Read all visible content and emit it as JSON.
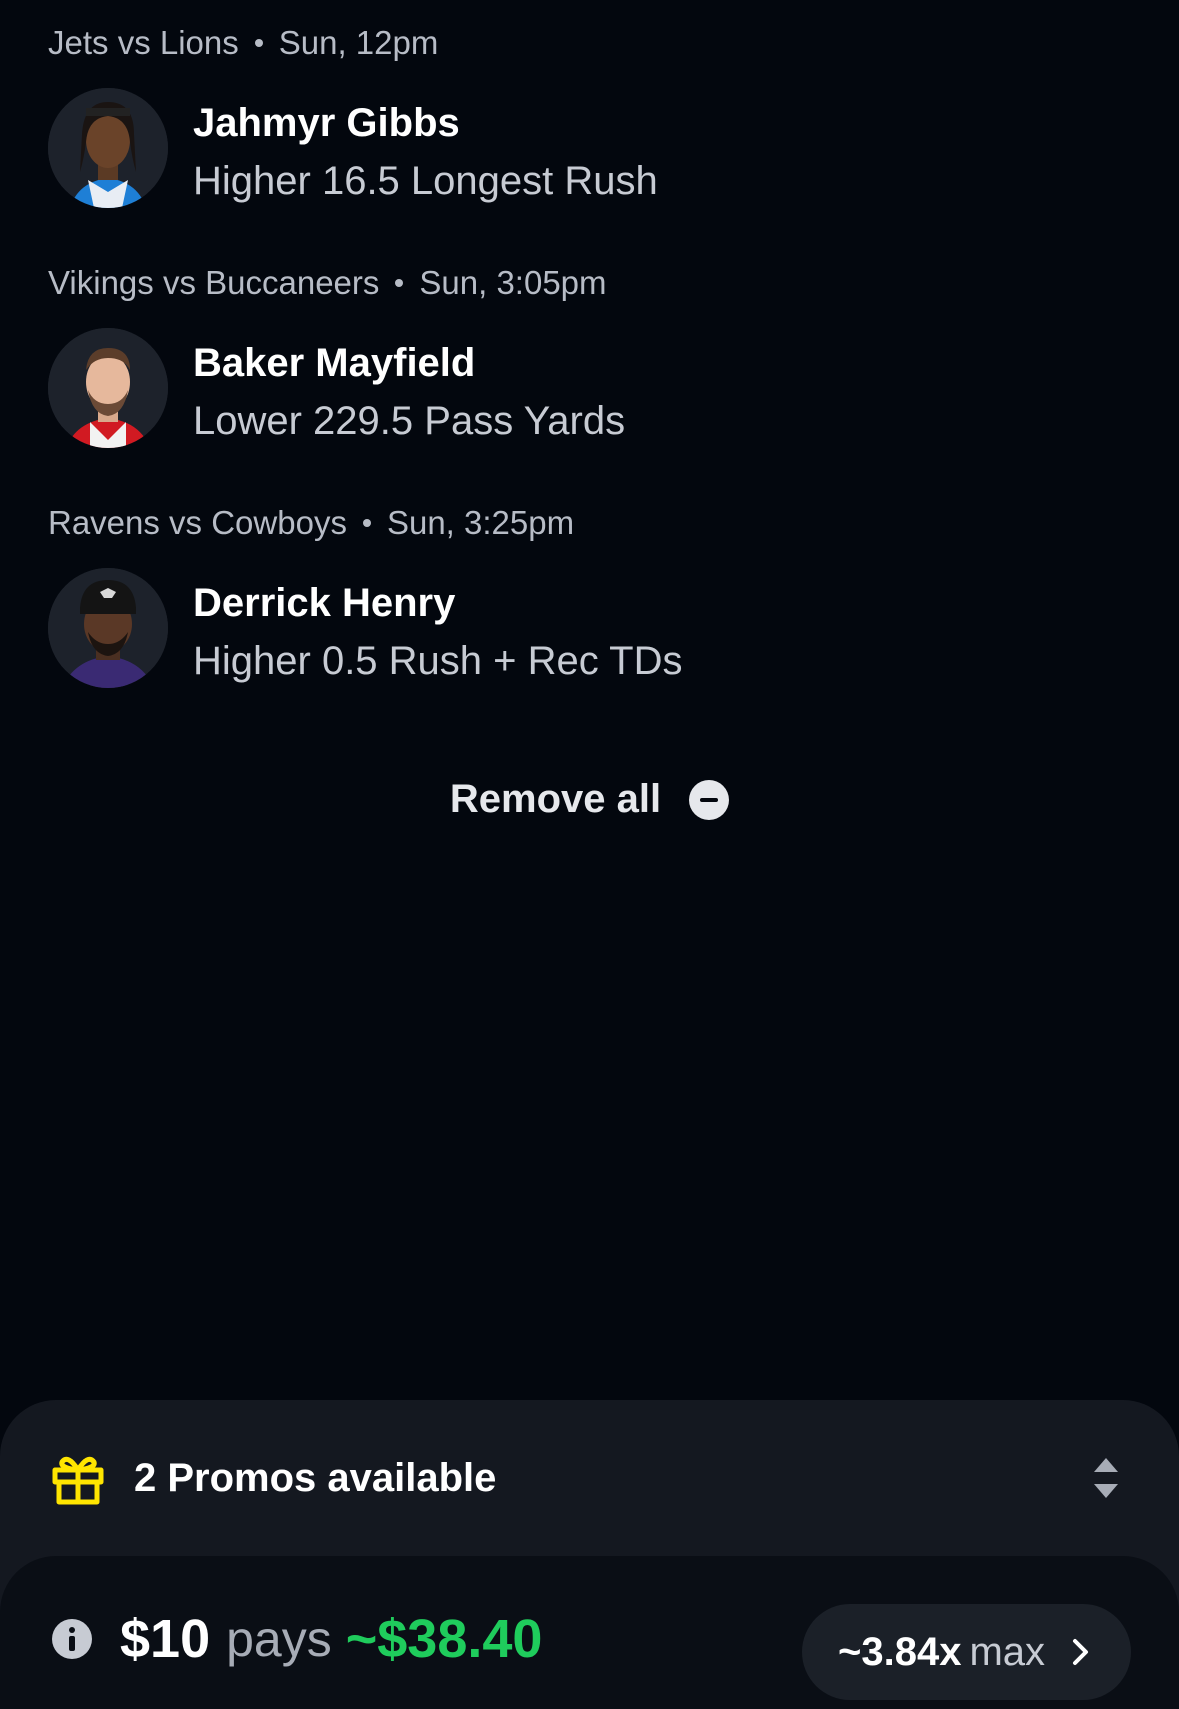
{
  "picks": [
    {
      "game": "Jets vs Lions",
      "time": "Sun, 12pm",
      "player": "Jahmyr Gibbs",
      "prop": "Higher 16.5 Longest Rush",
      "jersey_color": "#1e7fd6"
    },
    {
      "game": "Vikings vs Buccaneers",
      "time": "Sun, 3:05pm",
      "player": "Baker Mayfield",
      "prop": "Lower 229.5 Pass Yards",
      "jersey_color": "#d11a22"
    },
    {
      "game": "Ravens vs Cowboys",
      "time": "Sun, 3:25pm",
      "player": "Derrick Henry",
      "prop": "Higher 0.5 Rush + Rec TDs",
      "jersey_color": "#3a2a73"
    }
  ],
  "remove_all": {
    "label": "Remove all",
    "icon": "minus-circle-icon"
  },
  "promos": {
    "label": "2 Promos available",
    "icon": "gift-icon",
    "icon_color": "#ffe500"
  },
  "payout": {
    "stake": "$10",
    "pays_label": "pays",
    "amount": "~$38.40",
    "amount_color": "#1fcc5c",
    "multiplier": "~3.84x",
    "multiplier_suffix": "max"
  }
}
